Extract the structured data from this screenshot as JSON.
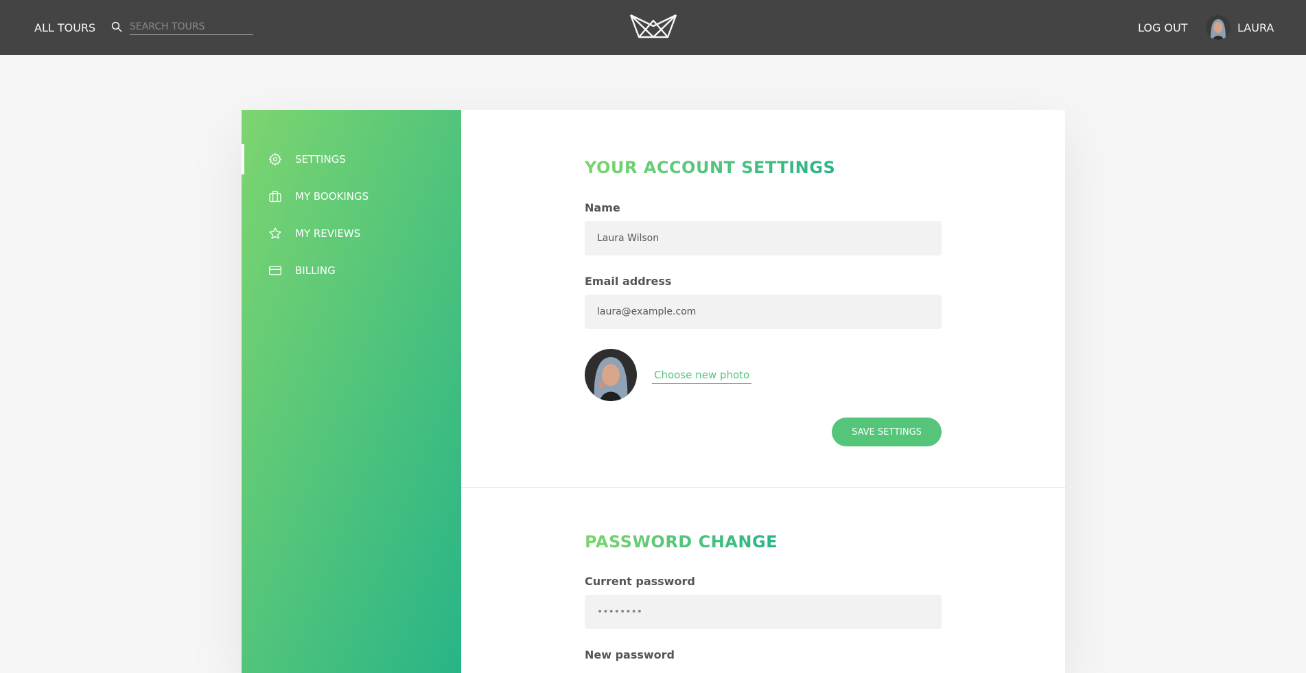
{
  "header": {
    "all_tours_label": "All tours",
    "search_placeholder": "Search tours",
    "logout_label": "Log out",
    "user_name": "Laura"
  },
  "sidebar": {
    "items": [
      {
        "label": "Settings",
        "icon": "gear-icon",
        "active": true
      },
      {
        "label": "My bookings",
        "icon": "briefcase-icon",
        "active": false
      },
      {
        "label": "My reviews",
        "icon": "star-icon",
        "active": false
      },
      {
        "label": "Billing",
        "icon": "credit-card-icon",
        "active": false
      }
    ]
  },
  "account_settings": {
    "heading": "Your account settings",
    "name_label": "Name",
    "name_value": "Laura Wilson",
    "email_label": "Email address",
    "email_value": "laura@example.com",
    "choose_photo_label": "Choose new photo",
    "save_label": "Save settings"
  },
  "password_change": {
    "heading": "Password change",
    "current_password_label": "Current password",
    "current_password_placeholder": "••••••••",
    "new_password_label": "New password"
  },
  "colors": {
    "header_bg": "#444444",
    "accent_green": "#55c57a",
    "gradient_start": "#7dd56f",
    "gradient_end": "#28b487"
  }
}
